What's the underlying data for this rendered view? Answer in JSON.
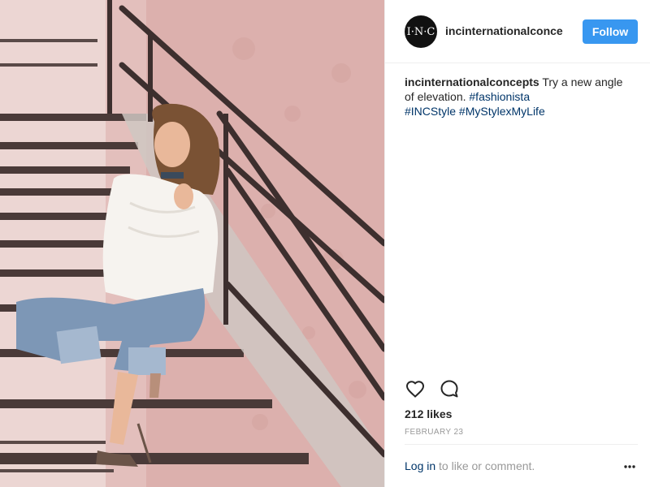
{
  "post": {
    "header": {
      "avatar_text": "I·N·C",
      "username": "incinternationalconce",
      "follow_label": "Follow"
    },
    "caption": {
      "username": "incinternationalconcepts",
      "text": "Try a new angle of elevation.",
      "hashtags": [
        "#fashionista",
        "#INCStyle",
        "#MyStylexMyLife"
      ]
    },
    "actions": {
      "like_icon": "heart-icon",
      "comment_icon": "comment-icon"
    },
    "likes": "212 likes",
    "date": "FEBRUARY 23",
    "footer": {
      "login_link": "Log in",
      "login_suffix": " to like or comment.",
      "more_icon": "more-options-icon"
    },
    "colors": {
      "follow_button": "#3897f0",
      "link": "#003569",
      "text": "#262626",
      "muted": "#999999",
      "divider": "#efefef"
    }
  }
}
